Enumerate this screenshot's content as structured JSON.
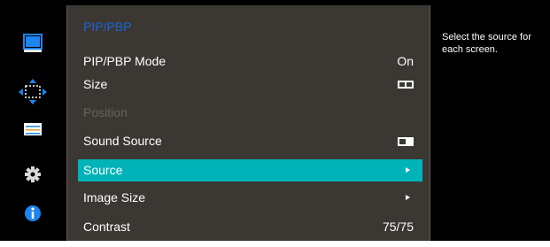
{
  "menu": {
    "title": "PIP/PBP",
    "items": [
      {
        "label": "PIP/PBP Mode",
        "value": "On",
        "kind": "text",
        "enabled": true,
        "selected": false
      },
      {
        "label": "Size",
        "value": "",
        "kind": "size-icon",
        "enabled": true,
        "selected": false
      },
      {
        "label": "Position",
        "value": "",
        "kind": "none",
        "enabled": false,
        "selected": false
      },
      {
        "label": "Sound Source",
        "value": "",
        "kind": "sound-icon",
        "enabled": true,
        "selected": false
      },
      {
        "label": "Source",
        "value": "",
        "kind": "arrow",
        "enabled": true,
        "selected": true
      },
      {
        "label": "Image Size",
        "value": "",
        "kind": "arrow",
        "enabled": true,
        "selected": false
      },
      {
        "label": "Contrast",
        "value": "75/75",
        "kind": "text",
        "enabled": true,
        "selected": false
      }
    ]
  },
  "help": {
    "text": "Select the source for each screen."
  },
  "nav_icons": [
    "monitor-icon",
    "move-arrows-icon",
    "sliders-icon",
    "gear-icon",
    "info-icon"
  ],
  "colors": {
    "panel": "#3b3834",
    "highlight": "#00b3b8",
    "title": "#1d62d8",
    "disabled_text": "#66625d",
    "icon_blue": "#1b85f0"
  }
}
